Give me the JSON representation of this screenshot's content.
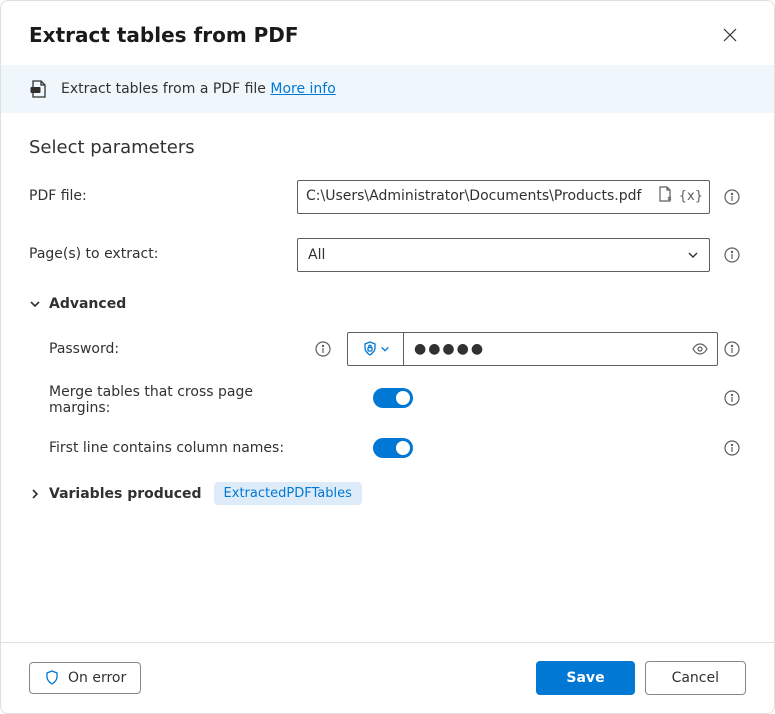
{
  "header": {
    "title": "Extract tables from PDF"
  },
  "info_bar": {
    "text": "Extract tables from a PDF file ",
    "link": "More info"
  },
  "section_title": "Select parameters",
  "pdf_file": {
    "label": "PDF file:",
    "value": "C:\\Users\\Administrator\\Documents\\Products.pdf"
  },
  "pages": {
    "label": "Page(s) to extract:",
    "value": "All"
  },
  "advanced": {
    "label": "Advanced",
    "password": {
      "label": "Password:",
      "masked": "●●●●●"
    },
    "merge": {
      "label": "Merge tables that cross page margins:",
      "on": true
    },
    "first_line": {
      "label": "First line contains column names:",
      "on": true
    }
  },
  "variables": {
    "label": "Variables produced",
    "badge": "ExtractedPDFTables"
  },
  "footer": {
    "on_error": "On error",
    "save": "Save",
    "cancel": "Cancel"
  }
}
